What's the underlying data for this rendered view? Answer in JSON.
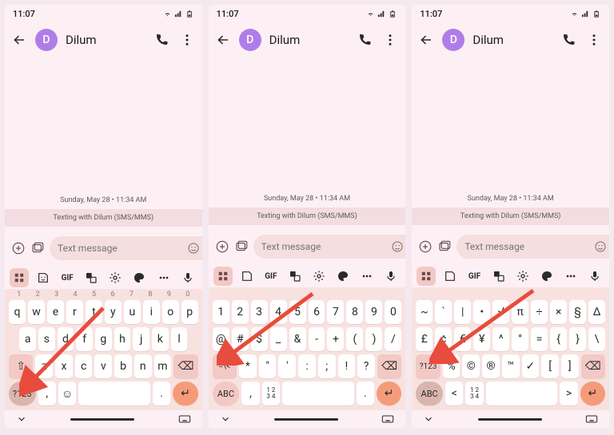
{
  "status": {
    "time": "11:07"
  },
  "header": {
    "contact_initial": "D",
    "contact_name": "Dilum"
  },
  "chat": {
    "timestamp_line": "Sunday, May 28 • 11:34 AM",
    "sms_banner": "Texting with Dilum (SMS/MMS)"
  },
  "compose": {
    "placeholder": "Text message"
  },
  "kbd_toolbar": {
    "gif_label": "GIF"
  },
  "screens": [
    {
      "numrow": [
        "1",
        "2",
        "3",
        "4",
        "5",
        "6",
        "7",
        "8",
        "9",
        "0"
      ],
      "row1": [
        "q",
        "w",
        "e",
        "r",
        "t",
        "y",
        "u",
        "i",
        "o",
        "p"
      ],
      "row2": [
        "a",
        "s",
        "d",
        "f",
        "g",
        "h",
        "j",
        "k",
        "l"
      ],
      "row3_mid": [
        "z",
        "x",
        "c",
        "v",
        "b",
        "n",
        "m"
      ],
      "shift_label": "⇧",
      "bksp_label": "⌫",
      "mode_label": "?123",
      "comma": ",",
      "emoji": "☺",
      "period": ".",
      "enter": "↵"
    },
    {
      "row1": [
        "1",
        "2",
        "3",
        "4",
        "5",
        "6",
        "7",
        "8",
        "9",
        "0"
      ],
      "row2": [
        "@",
        "#",
        "$",
        "_",
        "&",
        "-",
        "+",
        "(",
        ")",
        "/"
      ],
      "row3_mid": [
        "*",
        "\"",
        "'",
        ":",
        ";",
        "!",
        "?"
      ],
      "shift_label": "=\\<",
      "bksp_label": "⌫",
      "mode_label": "ABC",
      "comma": ",",
      "frac_top": "1 2",
      "frac_bot": "3 4",
      "period": ".",
      "enter": "↵"
    },
    {
      "row1": [
        "~",
        "`",
        "|",
        "•",
        "√",
        "π",
        "÷",
        "×",
        "§",
        "Δ"
      ],
      "row2": [
        "£",
        "¢",
        "€",
        "¥",
        "^",
        "°",
        "=",
        "{",
        "}",
        "\\"
      ],
      "row3_mid": [
        "%",
        "©",
        "®",
        "™",
        "✓",
        "[",
        "]"
      ],
      "shift_label": "?123",
      "bksp_label": "⌫",
      "mode_label": "ABC",
      "comma": "<",
      "frac_top": "1 2",
      "frac_bot": "3 4",
      "period": ">",
      "enter": "↵"
    }
  ]
}
